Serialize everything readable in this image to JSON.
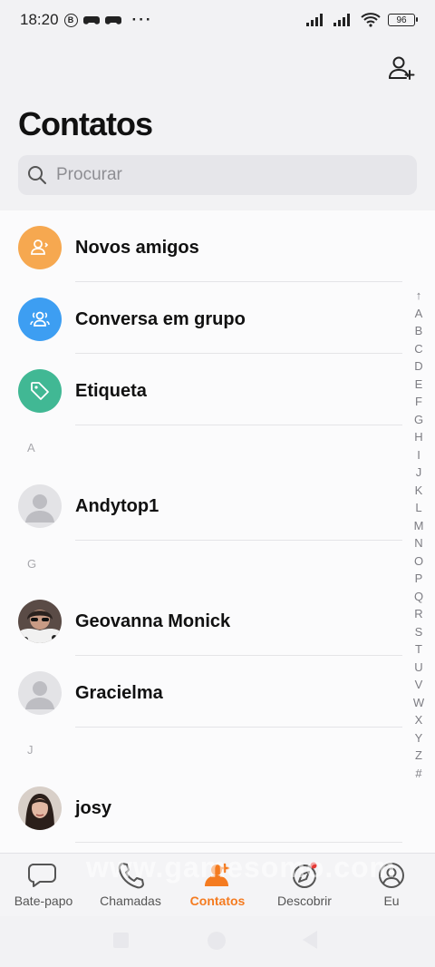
{
  "status_bar": {
    "time": "18:20",
    "badge": "B",
    "more": "···",
    "battery": "96"
  },
  "header": {
    "title": "Contatos",
    "add_contact_icon": "add-user-icon"
  },
  "search": {
    "placeholder": "Procurar"
  },
  "shortcuts": [
    {
      "label": "Novos amigos",
      "icon": "new-friends-icon",
      "color": "#f6a850"
    },
    {
      "label": "Conversa em grupo",
      "icon": "group-icon",
      "color": "#3d9ef2"
    },
    {
      "label": "Etiqueta",
      "icon": "tag-icon",
      "color": "#41b894"
    }
  ],
  "sections": [
    {
      "letter": "A",
      "contacts": [
        {
          "name": "Andytop1",
          "avatar": "default"
        }
      ]
    },
    {
      "letter": "G",
      "contacts": [
        {
          "name": "Geovanna Monick",
          "avatar": "photo"
        },
        {
          "name": "Gracielma",
          "avatar": "default"
        }
      ]
    },
    {
      "letter": "J",
      "contacts": [
        {
          "name": "josy",
          "avatar": "photo"
        }
      ]
    }
  ],
  "alphabet_index": [
    "↑",
    "A",
    "B",
    "C",
    "D",
    "E",
    "F",
    "G",
    "H",
    "I",
    "J",
    "K",
    "L",
    "M",
    "N",
    "O",
    "P",
    "Q",
    "R",
    "S",
    "T",
    "U",
    "V",
    "W",
    "X",
    "Y",
    "Z",
    "#"
  ],
  "tabs": [
    {
      "label": "Bate-papo",
      "icon": "chat-icon",
      "active": false
    },
    {
      "label": "Chamadas",
      "icon": "phone-icon",
      "active": false
    },
    {
      "label": "Contatos",
      "icon": "contacts-icon",
      "active": true
    },
    {
      "label": "Descobrir",
      "icon": "compass-icon",
      "active": false
    },
    {
      "label": "Eu",
      "icon": "profile-icon",
      "active": false
    }
  ],
  "watermark": "www.gamesomo.com",
  "colors": {
    "accent": "#f47b20",
    "notification_dot": "#e53935"
  }
}
